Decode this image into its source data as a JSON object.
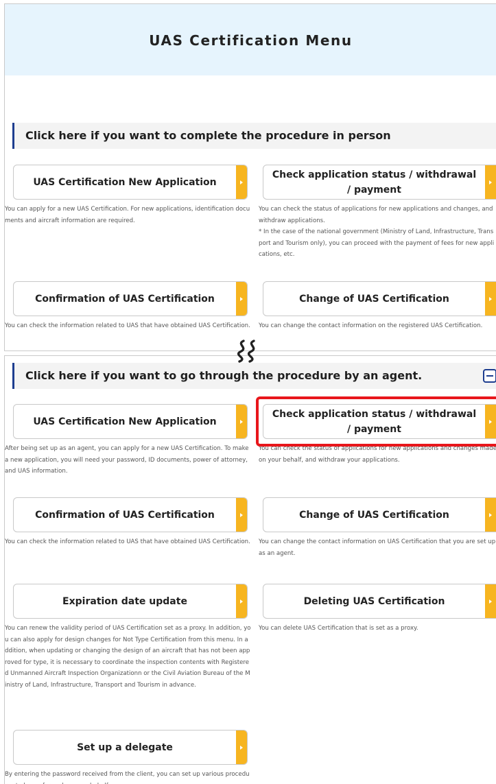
{
  "header": {
    "title": "UAS Certification Menu"
  },
  "in_person": {
    "section_title": "Click here if you want to complete the procedure in person",
    "new_application": {
      "label": "UAS Certification New Application",
      "desc": "You can apply for a new UAS Certification. For new applications, identification documents and aircraft information are required."
    },
    "check_status": {
      "label": "Check application status / withdrawal / payment",
      "desc": "You can check the status of applications for new applications and changes, and withdraw applications.",
      "note": "* In the case of the national government (Ministry of Land, Infrastructure, Transport and Tourism only), you can proceed with the payment of fees for new applications, etc."
    },
    "confirmation": {
      "label": "Confirmation of UAS Certification",
      "desc": "You can check the information related to UAS that have obtained UAS Certification."
    },
    "change": {
      "label": "Change of UAS Certification",
      "desc": "You can change the contact information on the registered UAS Certification."
    }
  },
  "agent": {
    "section_title": "Click here if you want to go through the procedure by an agent.",
    "new_application": {
      "label": "UAS Certification New Application",
      "desc": "After being set up as an agent, you can apply for a new UAS Certification. To make a new application, you will need your password, ID documents, power of attorney, and UAS information."
    },
    "check_status": {
      "label": "Check application status / withdrawal / payment",
      "desc": "You can check the status of applications for new applications and changes made on your behalf, and withdraw your applications."
    },
    "confirmation": {
      "label": "Confirmation of UAS Certification",
      "desc": "You can check the information related to UAS that have obtained UAS Certification."
    },
    "change": {
      "label": "Change of UAS Certification",
      "desc": "You can change the contact information on UAS Certification that you are set up as an agent."
    },
    "expiration": {
      "label": "Expiration date update",
      "desc": "You can renew the validity period of UAS Certification set as a proxy. In addition, you can also apply for design changes for Not Type Certification from this menu. In addition, when updating or changing the design of an aircraft that has not been approved for type, it is necessary to coordinate the inspection contents with Registered Unmanned Aircraft Inspection Organizationn or the Civil Aviation Bureau of the Ministry of Land, Infrastructure, Transport and Tourism in advance."
    },
    "deleting": {
      "label": "Deleting UAS Certification",
      "desc": "You can delete UAS Certification that is set as a proxy."
    },
    "delegate": {
      "label": "Set up a delegate",
      "desc": "By entering the password received from the client, you can set up various procedures to be performed on your behalf."
    }
  },
  "colors": {
    "accent": "#f7b520",
    "section_border": "#1d3d8f",
    "header_bg": "#e6f4fd",
    "highlight": "#e8161b"
  },
  "icons": {
    "arrow": "chevron-right-icon",
    "collapse": "minus-icon"
  }
}
